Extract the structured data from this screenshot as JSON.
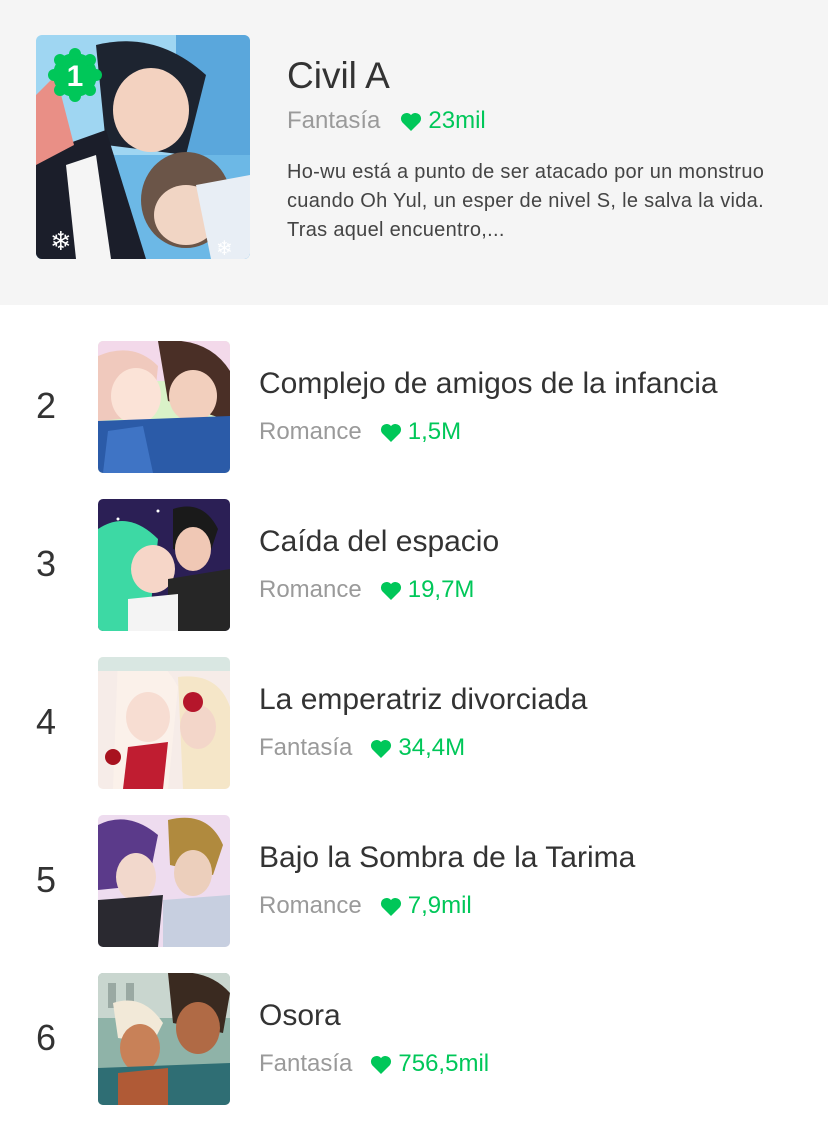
{
  "featured": {
    "rank": "1",
    "title": "Civil A",
    "genre": "Fantasía",
    "likes": "23mil",
    "description": "Ho-wu está a punto de ser atacado por un monstruo cuando Oh Yul, un esper de nivel S, le salva la vida. Tras aquel encuentro,..."
  },
  "rankings": [
    {
      "rank": "2",
      "title": "Complejo de amigos de la infancia",
      "genre": "Romance",
      "likes": "1,5M"
    },
    {
      "rank": "3",
      "title": "Caída del espacio",
      "genre": "Romance",
      "likes": "19,7M"
    },
    {
      "rank": "4",
      "title": "La emperatriz divorciada",
      "genre": "Fantasía",
      "likes": "34,4M"
    },
    {
      "rank": "5",
      "title": "Bajo la Sombra de la Tarima",
      "genre": "Romance",
      "likes": "7,9mil"
    },
    {
      "rank": "6",
      "title": "Osora",
      "genre": "Fantasía",
      "likes": "756,5mil"
    }
  ],
  "colors": {
    "accent": "#00c759",
    "featured_bg": "#f5f5f5",
    "title_text": "#333333",
    "genre_text": "#9a9a9a"
  },
  "icons": {
    "like": "heart-icon",
    "rank_badge": "rank-badge-icon"
  }
}
